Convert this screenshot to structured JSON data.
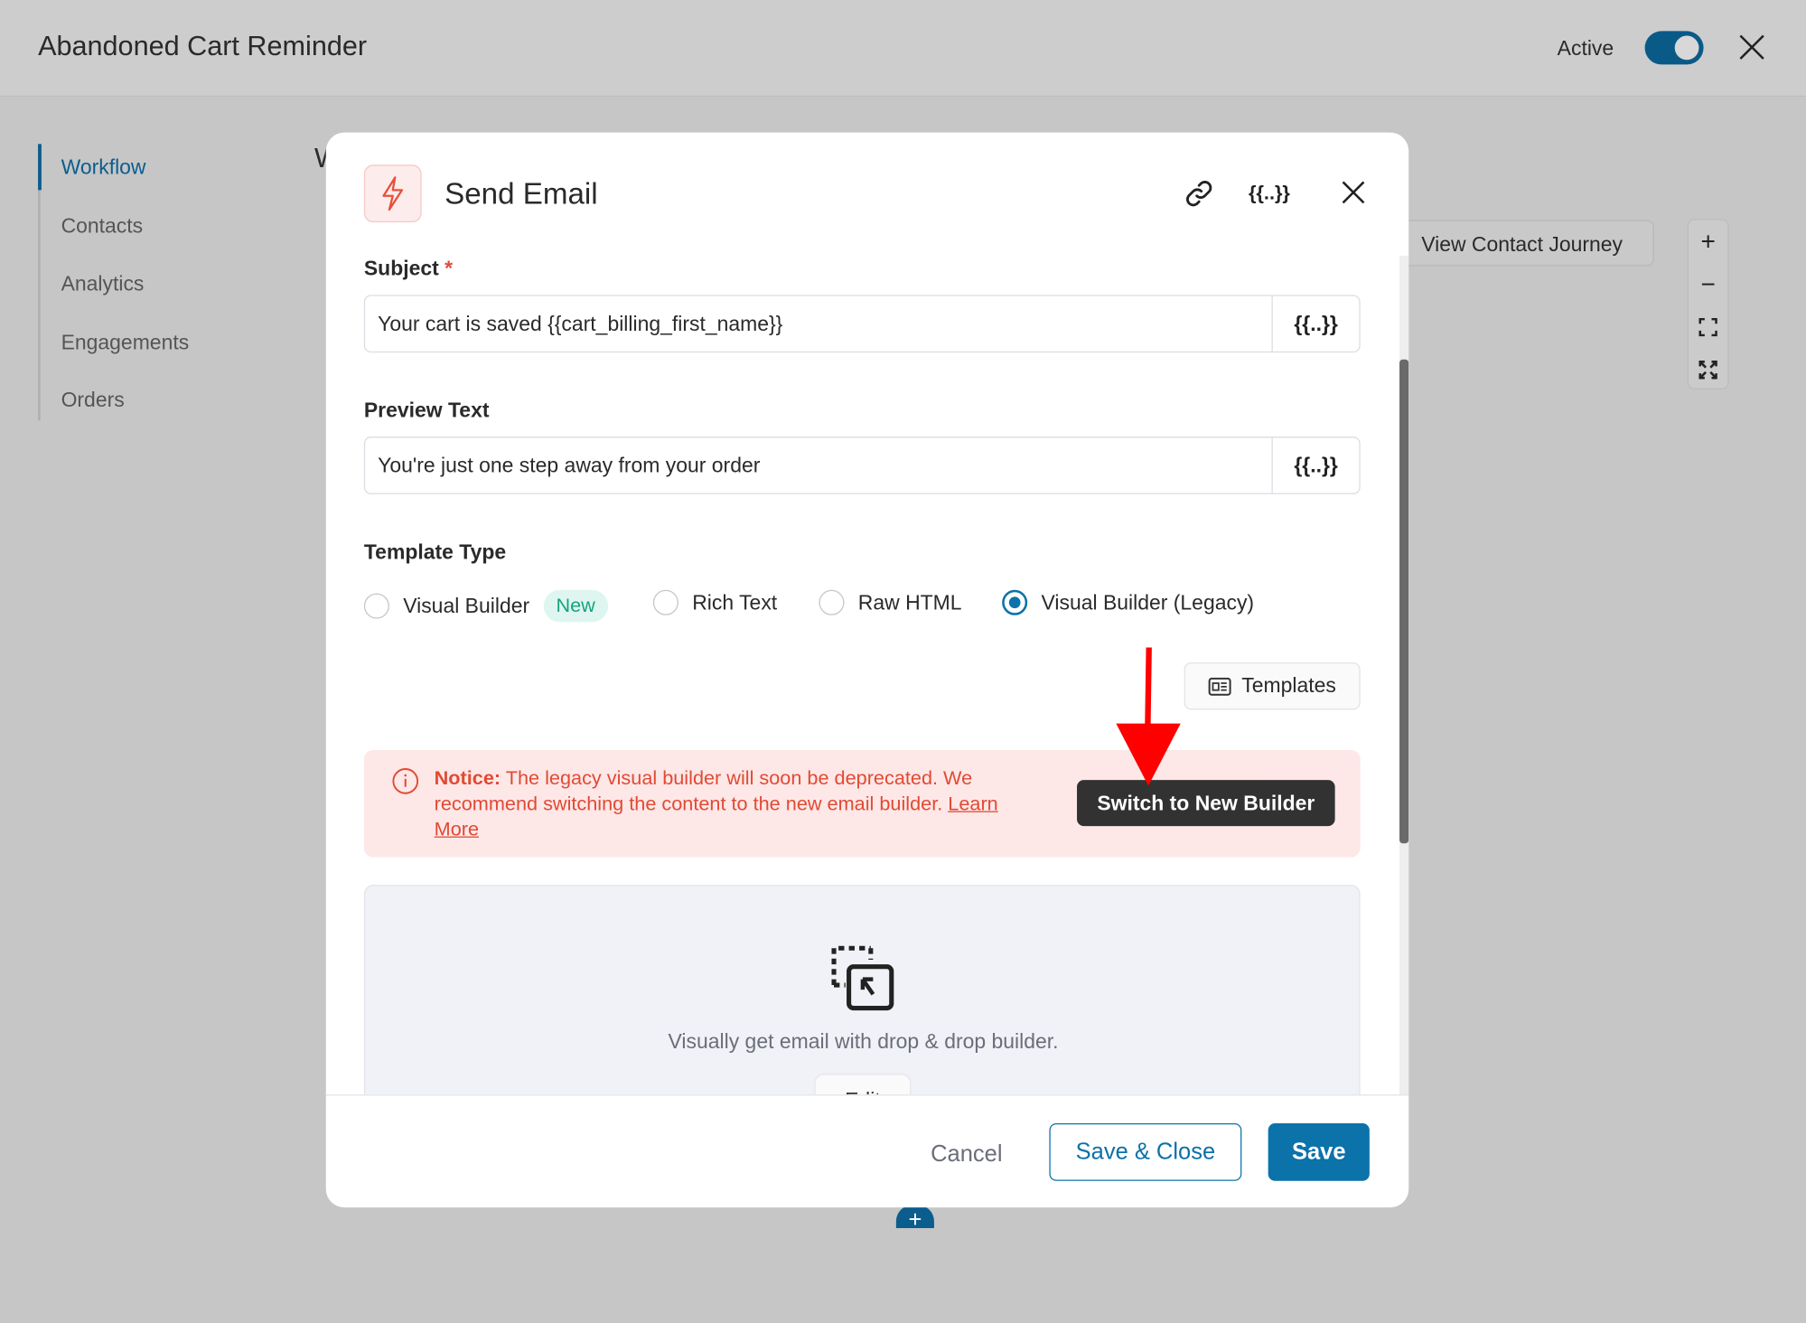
{
  "header": {
    "title": "Abandoned Cart Reminder",
    "active_label": "Active",
    "active": true
  },
  "sidebar": {
    "items": [
      {
        "label": "Workflow",
        "active": true
      },
      {
        "label": "Contacts"
      },
      {
        "label": "Analytics"
      },
      {
        "label": "Engagements"
      },
      {
        "label": "Orders"
      }
    ]
  },
  "background": {
    "partial_heading": "W",
    "view_contact_journey": "View Contact Journey",
    "zoom": {
      "in": "+",
      "out": "−"
    },
    "add": "+"
  },
  "modal": {
    "title": "Send Email",
    "merge_tag": "{{..}}",
    "subject": {
      "label": "Subject",
      "required": "*",
      "value": "Your cart is saved {{cart_billing_first_name}}"
    },
    "preview": {
      "label": "Preview Text",
      "value": "You're just one step away from your order"
    },
    "template_type": {
      "label": "Template Type",
      "options": [
        {
          "label": "Visual Builder",
          "badge": "New"
        },
        {
          "label": "Rich Text"
        },
        {
          "label": "Raw HTML"
        },
        {
          "label": "Visual Builder (Legacy)",
          "selected": true
        }
      ]
    },
    "templates_button": "Templates",
    "notice": {
      "prefix": "Notice:",
      "text": " The legacy visual builder will soon be deprecated. We recommend switching the content to the new email builder. ",
      "link": "Learn More",
      "button": "Switch to New Builder"
    },
    "builder": {
      "text": "Visually get email with drop & drop builder.",
      "edit": "Edit"
    },
    "footer": {
      "cancel": "Cancel",
      "save_close": "Save & Close",
      "save": "Save"
    }
  },
  "colors": {
    "primary": "#0b72aa",
    "notice_bg": "#fde7e7",
    "notice_text": "#e14a33",
    "annotation_arrow": "#ff0000"
  }
}
